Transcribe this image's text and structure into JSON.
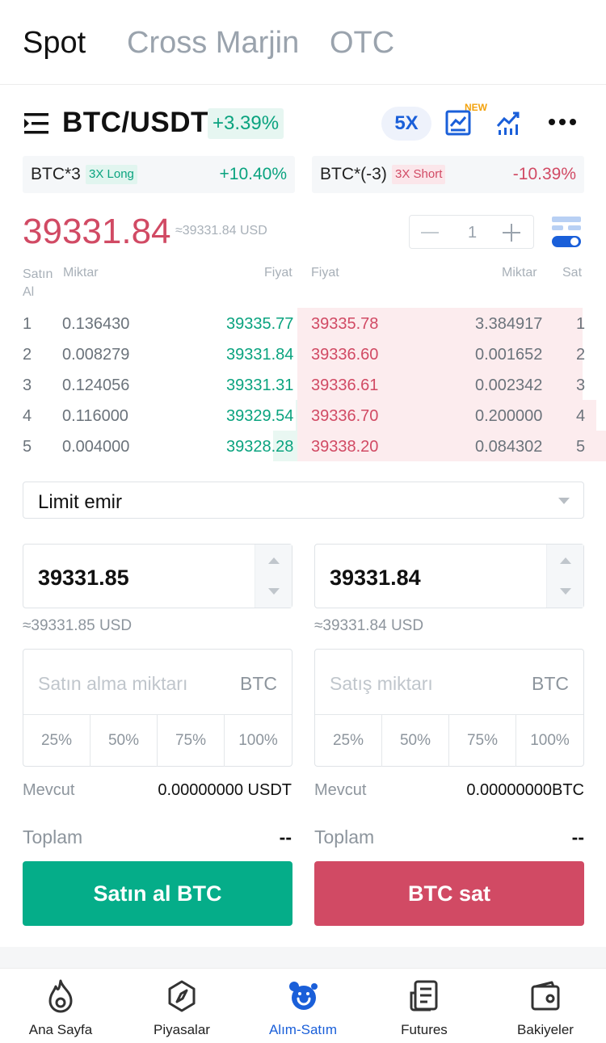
{
  "top_tabs": {
    "spot": "Spot",
    "cross": "Cross Marjin",
    "otc": "OTC"
  },
  "pair": {
    "name": "BTC/USDT",
    "change": "+3.39%",
    "leverage": "5X",
    "new_tag": "NEW"
  },
  "leveraged": [
    {
      "name": "BTC*3",
      "tag": "3X Long",
      "change": "+10.40%"
    },
    {
      "name": "BTC*(-3)",
      "tag": "3X Short",
      "change": "-10.39%"
    }
  ],
  "price": {
    "last": "39331.84",
    "usd": "≈39331.84 USD",
    "depth_step": "1"
  },
  "orderbook": {
    "headers": {
      "buy": "Satın Al",
      "qty_left": "Miktar",
      "price_left": "Fiyat",
      "price_right": "Fiyat",
      "qty_right": "Miktar",
      "sell": "Sat"
    },
    "rows": [
      {
        "i": "1",
        "bid_qty": "0.136430",
        "bid": "39335.77",
        "ask": "39335.78",
        "ask_qty": "3.384917",
        "j": "1"
      },
      {
        "i": "2",
        "bid_qty": "0.008279",
        "bid": "39331.84",
        "ask": "39336.60",
        "ask_qty": "0.001652",
        "j": "2"
      },
      {
        "i": "3",
        "bid_qty": "0.124056",
        "bid": "39331.31",
        "ask": "39336.61",
        "ask_qty": "0.002342",
        "j": "3"
      },
      {
        "i": "4",
        "bid_qty": "0.116000",
        "bid": "39329.54",
        "ask": "39336.70",
        "ask_qty": "0.200000",
        "j": "4"
      },
      {
        "i": "5",
        "bid_qty": "0.004000",
        "bid": "39328.28",
        "ask": "39338.20",
        "ask_qty": "0.084302",
        "j": "5"
      }
    ]
  },
  "order_type": {
    "value": "Limit emir"
  },
  "buy": {
    "price": "39331.85",
    "approx": "≈39331.85 USD",
    "amount_placeholder": "Satın alma miktarı",
    "unit": "BTC",
    "pcts": [
      "25%",
      "50%",
      "75%",
      "100%"
    ],
    "available_label": "Mevcut",
    "available": "0.00000000 USDT",
    "total_label": "Toplam",
    "total": "--",
    "button": "Satın al BTC"
  },
  "sell": {
    "price": "39331.84",
    "approx": "≈39331.84 USD",
    "amount_placeholder": "Satış miktarı",
    "unit": "BTC",
    "pcts": [
      "25%",
      "50%",
      "75%",
      "100%"
    ],
    "available_label": "Mevcut",
    "available": "0.00000000BTC",
    "total_label": "Toplam",
    "total": "--",
    "button": "BTC sat"
  },
  "nav": [
    {
      "label": "Ana Sayfa",
      "icon": "flame-icon"
    },
    {
      "label": "Piyasalar",
      "icon": "compass-icon"
    },
    {
      "label": "Alım-Satım",
      "icon": "trade-icon",
      "active": true
    },
    {
      "label": "Futures",
      "icon": "document-icon"
    },
    {
      "label": "Bakiyeler",
      "icon": "wallet-icon"
    }
  ],
  "colors": {
    "green": "#05ad89",
    "red": "#d14a64",
    "blue": "#1a5fd9"
  }
}
